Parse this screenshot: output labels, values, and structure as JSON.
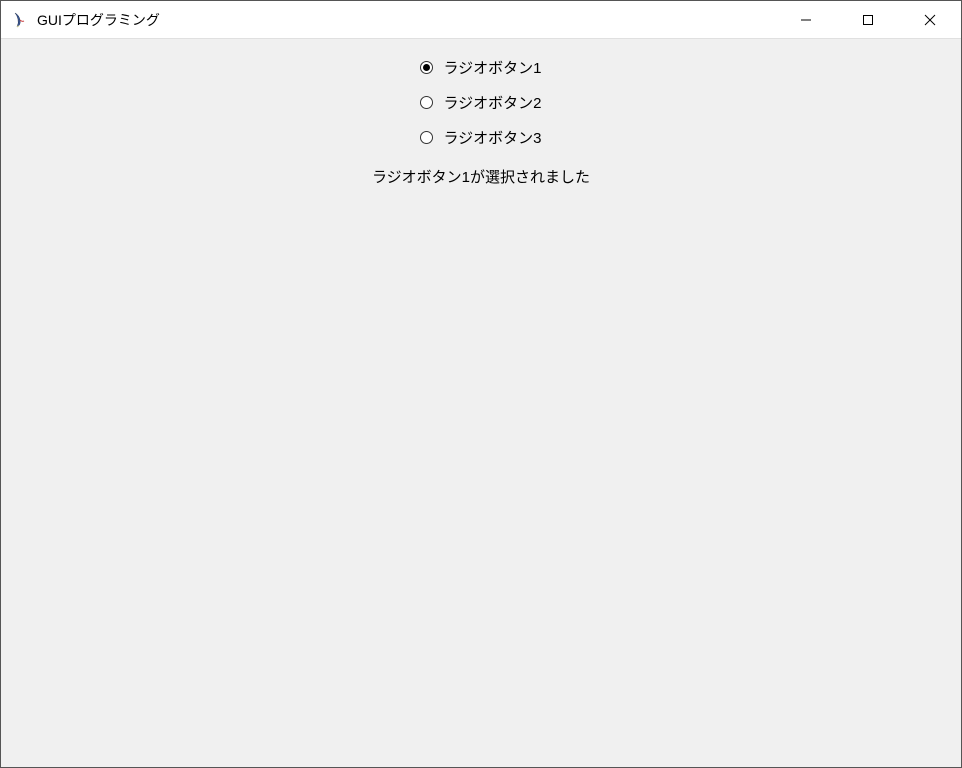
{
  "window": {
    "title": "GUIプログラミング"
  },
  "radios": [
    {
      "label": "ラジオボタン1",
      "selected": true
    },
    {
      "label": "ラジオボタン2",
      "selected": false
    },
    {
      "label": "ラジオボタン3",
      "selected": false
    }
  ],
  "status": "ラジオボタン1が選択されました"
}
